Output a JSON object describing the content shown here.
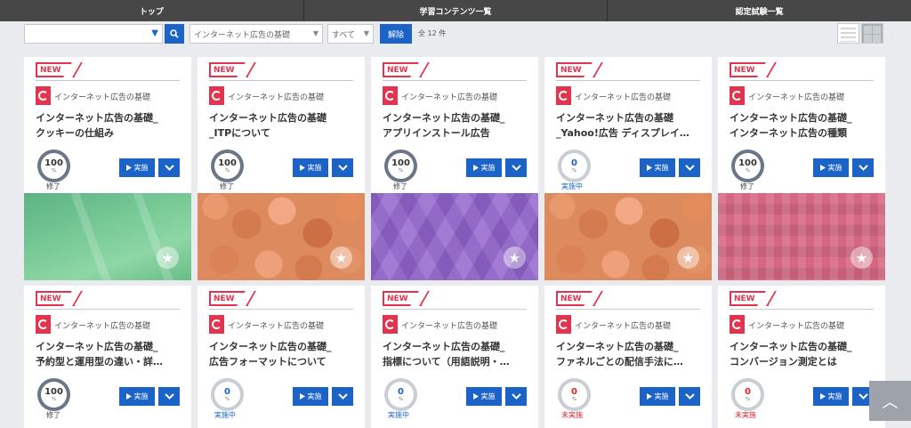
{
  "nav": {
    "items": [
      "トップ",
      "学習コンテンツ一覧",
      "認定試験一覧"
    ]
  },
  "filters": {
    "select1_value": "",
    "select2_value": "インターネット広告の基礎",
    "select3_value": "すべて",
    "clear_label": "解除",
    "count_text": "全 12 件"
  },
  "icons": {
    "search": "search-icon",
    "list_view": "list-view-icon",
    "grid_view": "grid-view-icon",
    "favorite": "star-icon",
    "play": "play-icon",
    "dropdown": "chevron-down-icon",
    "scroll_top": "chevron-up-icon"
  },
  "colors": {
    "accent": "#1b63c7",
    "badge": "#e2344e",
    "nav": "#474747"
  },
  "card_common": {
    "badge": "NEW",
    "category": "インターネット広告の基礎",
    "run_label": "実施"
  },
  "cards": [
    {
      "title1": "インターネット広告の基礎_",
      "title2": "クッキーの仕組み",
      "progress": "100",
      "unit": "%",
      "status": "修了"
    },
    {
      "title1": "インターネット広告の基礎",
      "title2": "_ITPについて",
      "progress": "100",
      "unit": "%",
      "status": "修了"
    },
    {
      "title1": "インターネット広告の基礎_",
      "title2": "アプリインストール広告",
      "progress": "100",
      "unit": "%",
      "status": "修了"
    },
    {
      "title1": "インターネット広告の基礎",
      "title2": "_Yahoo!広告 ディスプレイ…",
      "progress": "0",
      "unit": "%",
      "status": "実施中"
    },
    {
      "title1": "インターネット広告の基礎_",
      "title2": "インターネット広告の種類",
      "progress": "100",
      "unit": "%",
      "status": "修了"
    },
    {
      "title1": "インターネット広告の基礎_",
      "title2": "予約型と運用型の違い・詳…",
      "progress": "100",
      "unit": "%",
      "status": "修了"
    },
    {
      "title1": "インターネット広告の基礎_",
      "title2": "広告フォーマットについて",
      "progress": "0",
      "unit": "%",
      "status": "実施中"
    },
    {
      "title1": "インターネット広告の基礎_",
      "title2": "指標について（用語説明・…",
      "progress": "0",
      "unit": "%",
      "status": "実施中"
    },
    {
      "title1": "インターネット広告の基礎_",
      "title2": "ファネルごとの配信手法に…",
      "progress": "0",
      "unit": "%",
      "status": "未実施"
    },
    {
      "title1": "インターネット広告の基礎_",
      "title2": "コンバージョン測定とは",
      "progress": "0",
      "unit": "%",
      "status": "未実施"
    }
  ]
}
